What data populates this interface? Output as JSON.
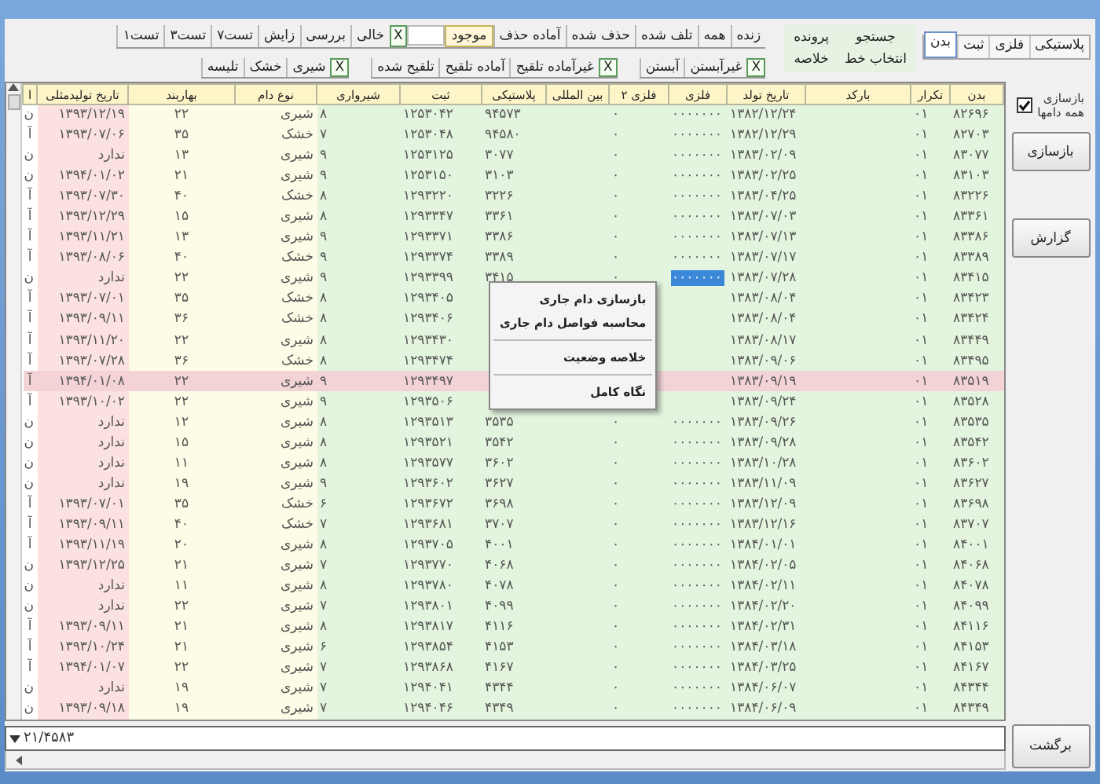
{
  "tabs": [
    {
      "label": "پلاستیکی",
      "selected": false
    },
    {
      "label": "فلزی",
      "selected": false
    },
    {
      "label": "ثبت",
      "selected": false
    },
    {
      "label": "بدن",
      "selected": true
    }
  ],
  "actions": [
    "جستجو",
    "پرونده",
    "انتخاب خط",
    "خلاصه"
  ],
  "filter_rows": [
    [
      [
        {
          "kind": "option",
          "label": "زنده",
          "selected": false
        },
        {
          "kind": "option",
          "label": "همه",
          "selected": false
        },
        {
          "kind": "option",
          "label": "تلف شده",
          "selected": false
        },
        {
          "kind": "option",
          "label": "حذف شده",
          "selected": false
        },
        {
          "kind": "option",
          "label": "آماده حذف",
          "selected": false
        },
        {
          "kind": "option",
          "label": "موجود",
          "selected": true
        },
        {
          "kind": "blank"
        },
        {
          "kind": "toggle",
          "label": "X"
        },
        {
          "kind": "option",
          "label": "خالی",
          "selected": false
        },
        {
          "kind": "option",
          "label": "بررسی",
          "selected": false
        },
        {
          "kind": "option",
          "label": "زایش",
          "selected": false
        },
        {
          "kind": "option",
          "label": "تست۷",
          "selected": false
        },
        {
          "kind": "option",
          "label": "تست۳",
          "selected": false
        },
        {
          "kind": "option",
          "label": "تست۱",
          "selected": false
        }
      ]
    ],
    [
      [
        {
          "kind": "toggle",
          "label": "X"
        },
        {
          "kind": "option",
          "label": "غیرآبستن",
          "selected": false
        },
        {
          "kind": "option",
          "label": "آبستن",
          "selected": false
        }
      ],
      [
        {
          "kind": "toggle",
          "label": "X"
        },
        {
          "kind": "option",
          "label": "غیرآماده تلقیح",
          "selected": false
        },
        {
          "kind": "option",
          "label": "آماده تلقیح",
          "selected": false
        },
        {
          "kind": "option",
          "label": "تلقیح شده",
          "selected": false
        }
      ],
      [
        {
          "kind": "toggle",
          "label": "X"
        },
        {
          "kind": "option",
          "label": "شیری",
          "selected": false
        },
        {
          "kind": "option",
          "label": "خشک",
          "selected": false
        },
        {
          "kind": "option",
          "label": "تلیسه",
          "selected": false
        }
      ]
    ]
  ],
  "table": {
    "columns": [
      "بدن",
      "تکرار",
      "بارکد",
      "تاریخ تولد",
      "فلزی",
      "فلزی ۲",
      "بین المللی",
      "پلاستیکی",
      "ثبت",
      "شیرواری",
      "نوع دام",
      "بهاربند",
      "تاریخ تولیدمثلی",
      "ا"
    ],
    "rows": [
      {
        "tag": "۸۲۶۹۶",
        "repeat": "۰۱",
        "birth_date": "۱۳۸۲/۱۲/۲۴",
        "metal": "۰۰۰۰۰۰۰",
        "metal_2": "۰",
        "plastic": "۹۴۵۷۳",
        "registration": "۱۲۵۳۰۴۲",
        "milking": "۸",
        "animal_type": "شیری",
        "pen": "۲۲",
        "repro_date": "۱۳۹۳/۱۲/۱۹",
        "column_14": "ن",
        "selected": false,
        "focused": false
      },
      {
        "tag": "۸۲۷۰۳",
        "repeat": "۰۱",
        "birth_date": "۱۳۸۲/۱۲/۲۹",
        "metal": "۰۰۰۰۰۰۰",
        "metal_2": "۰",
        "plastic": "۹۴۵۸۰",
        "registration": "۱۲۵۳۰۴۸",
        "milking": "۷",
        "animal_type": "خشک",
        "pen": "۳۵",
        "repro_date": "۱۳۹۳/۰۷/۰۶",
        "column_14": "آ",
        "selected": false,
        "focused": false
      },
      {
        "tag": "۸۳۰۷۷",
        "repeat": "۰۱",
        "birth_date": "۱۳۸۳/۰۲/۰۹",
        "metal": "۰۰۰۰۰۰۰",
        "metal_2": "۰",
        "plastic": "۳۰۷۷",
        "registration": "۱۲۵۳۱۲۵",
        "milking": "۹",
        "animal_type": "شیری",
        "pen": "۱۳",
        "repro_date": "ندارد",
        "column_14": "ن",
        "selected": false,
        "focused": false
      },
      {
        "tag": "۸۳۱۰۳",
        "repeat": "۰۱",
        "birth_date": "۱۳۸۳/۰۲/۲۵",
        "metal": "۰۰۰۰۰۰۰",
        "metal_2": "۰",
        "plastic": "۳۱۰۳",
        "registration": "۱۲۵۳۱۵۰",
        "milking": "۹",
        "animal_type": "شیری",
        "pen": "۲۱",
        "repro_date": "۱۳۹۴/۰۱/۰۲",
        "column_14": "ن",
        "selected": false,
        "focused": false
      },
      {
        "tag": "۸۳۲۲۶",
        "repeat": "۰۱",
        "birth_date": "۱۳۸۳/۰۴/۲۵",
        "metal": "۰۰۰۰۰۰۰",
        "metal_2": "۰",
        "plastic": "۳۲۲۶",
        "registration": "۱۲۹۳۲۲۰",
        "milking": "۸",
        "animal_type": "خشک",
        "pen": "۴۰",
        "repro_date": "۱۳۹۳/۰۷/۳۰",
        "column_14": "آ",
        "selected": false,
        "focused": false
      },
      {
        "tag": "۸۳۳۶۱",
        "repeat": "۰۱",
        "birth_date": "۱۳۸۳/۰۷/۰۳",
        "metal": "۰۰۰۰۰۰۰",
        "metal_2": "۰",
        "plastic": "۳۳۶۱",
        "registration": "۱۲۹۳۳۴۷",
        "milking": "۸",
        "animal_type": "شیری",
        "pen": "۱۵",
        "repro_date": "۱۳۹۳/۱۲/۲۹",
        "column_14": "آ",
        "selected": false,
        "focused": false
      },
      {
        "tag": "۸۳۳۸۶",
        "repeat": "۰۱",
        "birth_date": "۱۳۸۳/۰۷/۱۳",
        "metal": "۰۰۰۰۰۰۰",
        "metal_2": "۰",
        "plastic": "۳۳۸۶",
        "registration": "۱۲۹۳۳۷۱",
        "milking": "۹",
        "animal_type": "شیری",
        "pen": "۱۳",
        "repro_date": "۱۳۹۳/۱۱/۲۱",
        "column_14": "آ",
        "selected": false,
        "focused": false
      },
      {
        "tag": "۸۳۳۸۹",
        "repeat": "۰۱",
        "birth_date": "۱۳۸۳/۰۷/۱۷",
        "metal": "۰۰۰۰۰۰۰",
        "metal_2": "۰",
        "plastic": "۳۳۸۹",
        "registration": "۱۲۹۳۳۷۴",
        "milking": "۹",
        "animal_type": "خشک",
        "pen": "۴۰",
        "repro_date": "۱۳۹۳/۰۸/۰۶",
        "column_14": "آ",
        "selected": false,
        "focused": false
      },
      {
        "tag": "۸۳۴۱۵",
        "repeat": "۰۱",
        "birth_date": "۱۳۸۳/۰۷/۲۸",
        "metal": "۰۰۰۰۰۰۰",
        "metal_2": "۰",
        "plastic": "۳۴۱۵",
        "registration": "۱۲۹۳۳۹۹",
        "milking": "۹",
        "animal_type": "شیری",
        "pen": "۲۲",
        "repro_date": "ندارد",
        "column_14": "ن",
        "selected": false,
        "focused": true
      },
      {
        "tag": "۸۳۴۲۳",
        "repeat": "۰۱",
        "birth_date": "۱۳۸۳/۰۸/۰۴",
        "registration": "۱۲۹۳۴۰۵",
        "milking": "۸",
        "animal_type": "خشک",
        "pen": "۳۵",
        "repro_date": "۱۳۹۳/۰۷/۰۱",
        "column_14": "آ",
        "selected": false,
        "focused": false
      },
      {
        "tag": "۸۳۴۲۴",
        "repeat": "۰۱",
        "birth_date": "۱۳۸۳/۰۸/۰۴",
        "registration": "۱۲۹۳۴۰۶",
        "milking": "۸",
        "animal_type": "خشک",
        "pen": "۳۶",
        "repro_date": "۱۳۹۳/۰۹/۱۱",
        "column_14": "آ",
        "selected": false,
        "focused": false
      },
      {
        "tag": "۸۳۴۴۹",
        "repeat": "۰۱",
        "birth_date": "۱۳۸۳/۰۸/۱۷",
        "registration": "۱۲۹۳۴۳۰",
        "milking": "۸",
        "animal_type": "شیری",
        "pen": "۲۲",
        "repro_date": "۱۳۹۳/۱۱/۲۰",
        "column_14": "آ",
        "selected": false,
        "focused": false
      },
      {
        "tag": "۸۳۴۹۵",
        "repeat": "۰۱",
        "birth_date": "۱۳۸۳/۰۹/۰۶",
        "registration": "۱۲۹۳۴۷۴",
        "milking": "۸",
        "animal_type": "خشک",
        "pen": "۳۶",
        "repro_date": "۱۳۹۳/۰۷/۲۸",
        "column_14": "آ",
        "selected": false,
        "focused": false
      },
      {
        "tag": "۸۳۵۱۹",
        "repeat": "۰۱",
        "birth_date": "۱۳۸۳/۰۹/۱۹",
        "registration": "۱۲۹۳۴۹۷",
        "milking": "۹",
        "animal_type": "شیری",
        "pen": "۲۲",
        "repro_date": "۱۳۹۴/۰۱/۰۸",
        "column_14": "آ",
        "selected": true,
        "focused": false
      },
      {
        "tag": "۸۳۵۲۸",
        "repeat": "۰۱",
        "birth_date": "۱۳۸۳/۰۹/۲۴",
        "registration": "۱۲۹۳۵۰۶",
        "milking": "۹",
        "animal_type": "شیری",
        "pen": "۲۲",
        "repro_date": "۱۳۹۳/۱۰/۰۲",
        "column_14": "آ",
        "selected": false,
        "focused": false
      },
      {
        "tag": "۸۳۵۳۵",
        "repeat": "۰۱",
        "birth_date": "۱۳۸۳/۰۹/۲۶",
        "metal": "۰۰۰۰۰۰۰",
        "metal_2": "۰",
        "plastic": "۳۵۳۵",
        "registration": "۱۲۹۳۵۱۳",
        "milking": "۸",
        "animal_type": "شیری",
        "pen": "۱۲",
        "repro_date": "ندارد",
        "column_14": "ن",
        "selected": false,
        "focused": false
      },
      {
        "tag": "۸۳۵۴۲",
        "repeat": "۰۱",
        "birth_date": "۱۳۸۳/۰۹/۲۸",
        "metal": "۰۰۰۰۰۰۰",
        "metal_2": "۰",
        "plastic": "۳۵۴۲",
        "registration": "۱۲۹۳۵۲۱",
        "milking": "۸",
        "animal_type": "شیری",
        "pen": "۱۵",
        "repro_date": "ندارد",
        "column_14": "ن",
        "selected": false,
        "focused": false
      },
      {
        "tag": "۸۳۶۰۲",
        "repeat": "۰۱",
        "birth_date": "۱۳۸۳/۱۰/۲۸",
        "metal": "۰۰۰۰۰۰۰",
        "metal_2": "۰",
        "plastic": "۳۶۰۲",
        "registration": "۱۲۹۳۵۷۷",
        "milking": "۸",
        "animal_type": "شیری",
        "pen": "۱۱",
        "repro_date": "ندارد",
        "column_14": "ن",
        "selected": false,
        "focused": false
      },
      {
        "tag": "۸۳۶۲۷",
        "repeat": "۰۱",
        "birth_date": "۱۳۸۳/۱۱/۰۹",
        "metal": "۰۰۰۰۰۰۰",
        "metal_2": "۰",
        "plastic": "۳۶۲۷",
        "registration": "۱۲۹۳۶۰۲",
        "milking": "۹",
        "animal_type": "شیری",
        "pen": "۱۹",
        "repro_date": "ندارد",
        "column_14": "ن",
        "selected": false,
        "focused": false
      },
      {
        "tag": "۸۳۶۹۸",
        "repeat": "۰۱",
        "birth_date": "۱۳۸۳/۱۲/۰۹",
        "metal": "۰۰۰۰۰۰۰",
        "metal_2": "۰",
        "plastic": "۳۶۹۸",
        "registration": "۱۲۹۳۶۷۲",
        "milking": "۶",
        "animal_type": "خشک",
        "pen": "۳۵",
        "repro_date": "۱۳۹۳/۰۷/۰۱",
        "column_14": "آ",
        "selected": false,
        "focused": false
      },
      {
        "tag": "۸۳۷۰۷",
        "repeat": "۰۱",
        "birth_date": "۱۳۸۳/۱۲/۱۶",
        "metal": "۰۰۰۰۰۰۰",
        "metal_2": "۰",
        "plastic": "۳۷۰۷",
        "registration": "۱۲۹۳۶۸۱",
        "milking": "۷",
        "animal_type": "خشک",
        "pen": "۴۰",
        "repro_date": "۱۳۹۳/۰۹/۱۱",
        "column_14": "آ",
        "selected": false,
        "focused": false
      },
      {
        "tag": "۸۴۰۰۱",
        "repeat": "۰۱",
        "birth_date": "۱۳۸۴/۰۱/۰۱",
        "metal": "۰۰۰۰۰۰۰",
        "metal_2": "۰",
        "plastic": "۴۰۰۱",
        "registration": "۱۲۹۳۷۰۵",
        "milking": "۸",
        "animal_type": "شیری",
        "pen": "۲۰",
        "repro_date": "۱۳۹۳/۱۱/۱۹",
        "column_14": "آ",
        "selected": false,
        "focused": false
      },
      {
        "tag": "۸۴۰۶۸",
        "repeat": "۰۱",
        "birth_date": "۱۳۸۴/۰۲/۰۵",
        "metal": "۰۰۰۰۰۰۰",
        "metal_2": "۰",
        "plastic": "۴۰۶۸",
        "registration": "۱۲۹۳۷۷۰",
        "milking": "۷",
        "animal_type": "شیری",
        "pen": "۲۱",
        "repro_date": "۱۳۹۳/۱۲/۲۵",
        "column_14": "ن",
        "selected": false,
        "focused": false
      },
      {
        "tag": "۸۴۰۷۸",
        "repeat": "۰۱",
        "birth_date": "۱۳۸۴/۰۲/۱۱",
        "metal": "۰۰۰۰۰۰۰",
        "metal_2": "۰",
        "plastic": "۴۰۷۸",
        "registration": "۱۲۹۳۷۸۰",
        "milking": "۸",
        "animal_type": "شیری",
        "pen": "۱۱",
        "repro_date": "ندارد",
        "column_14": "ن",
        "selected": false,
        "focused": false
      },
      {
        "tag": "۸۴۰۹۹",
        "repeat": "۰۱",
        "birth_date": "۱۳۸۴/۰۲/۲۰",
        "metal": "۰۰۰۰۰۰۰",
        "metal_2": "۰",
        "plastic": "۴۰۹۹",
        "registration": "۱۲۹۳۸۰۱",
        "milking": "۷",
        "animal_type": "شیری",
        "pen": "۲۲",
        "repro_date": "ندارد",
        "column_14": "ن",
        "selected": false,
        "focused": false
      },
      {
        "tag": "۸۴۱۱۶",
        "repeat": "۰۱",
        "birth_date": "۱۳۸۴/۰۲/۳۱",
        "metal": "۰۰۰۰۰۰۰",
        "metal_2": "۰",
        "plastic": "۴۱۱۶",
        "registration": "۱۲۹۳۸۱۷",
        "milking": "۸",
        "animal_type": "شیری",
        "pen": "۲۱",
        "repro_date": "۱۳۹۳/۰۹/۱۱",
        "column_14": "آ",
        "selected": false,
        "focused": false
      },
      {
        "tag": "۸۴۱۵۳",
        "repeat": "۰۱",
        "birth_date": "۱۳۸۴/۰۳/۱۸",
        "metal": "۰۰۰۰۰۰۰",
        "metal_2": "۰",
        "plastic": "۴۱۵۳",
        "registration": "۱۲۹۳۸۵۴",
        "milking": "۶",
        "animal_type": "شیری",
        "pen": "۲۱",
        "repro_date": "۱۳۹۳/۱۰/۲۴",
        "column_14": "آ",
        "selected": false,
        "focused": false
      },
      {
        "tag": "۸۴۱۶۷",
        "repeat": "۰۱",
        "birth_date": "۱۳۸۴/۰۳/۲۵",
        "metal": "۰۰۰۰۰۰۰",
        "metal_2": "۰",
        "plastic": "۴۱۶۷",
        "registration": "۱۲۹۳۸۶۸",
        "milking": "۷",
        "animal_type": "شیری",
        "pen": "۲۲",
        "repro_date": "۱۳۹۴/۰۱/۰۷",
        "column_14": "آ",
        "selected": false,
        "focused": false
      },
      {
        "tag": "۸۴۳۴۴",
        "repeat": "۰۱",
        "birth_date": "۱۳۸۴/۰۶/۰۷",
        "metal": "۰۰۰۰۰۰۰",
        "metal_2": "۰",
        "plastic": "۴۳۴۴",
        "registration": "۱۲۹۴۰۴۱",
        "milking": "۷",
        "animal_type": "شیری",
        "pen": "۱۹",
        "repro_date": "ندارد",
        "column_14": "ن",
        "selected": false,
        "focused": false
      },
      {
        "tag": "۸۴۳۴۹",
        "repeat": "۰۱",
        "birth_date": "۱۳۸۴/۰۶/۰۹",
        "metal": "۰۰۰۰۰۰۰",
        "metal_2": "۰",
        "plastic": "۴۳۴۹",
        "registration": "۱۲۹۴۰۴۶",
        "milking": "۷",
        "animal_type": "شیری",
        "pen": "۱۹",
        "repro_date": "۱۳۹۳/۰۹/۱۸",
        "column_14": "ن",
        "selected": false,
        "focused": false
      }
    ]
  },
  "context_menu": [
    {
      "label": "بازسازی دام جاری"
    },
    {
      "label": "محاسبه فواصل دام جاری"
    },
    {
      "kind": "separator"
    },
    {
      "label": "خلاصه وضعیت"
    },
    {
      "kind": "separator"
    },
    {
      "label": "نگاه کامل"
    }
  ],
  "status_field": {
    "value": "۲۱/۴۵۸۳"
  },
  "side_panel": {
    "rebuild_all": {
      "label_lines": [
        "بازسازی",
        "همه دامها"
      ],
      "checked": true
    },
    "buttons": [
      "بازسازی",
      "گزارش"
    ],
    "back_button": "برگشت"
  }
}
